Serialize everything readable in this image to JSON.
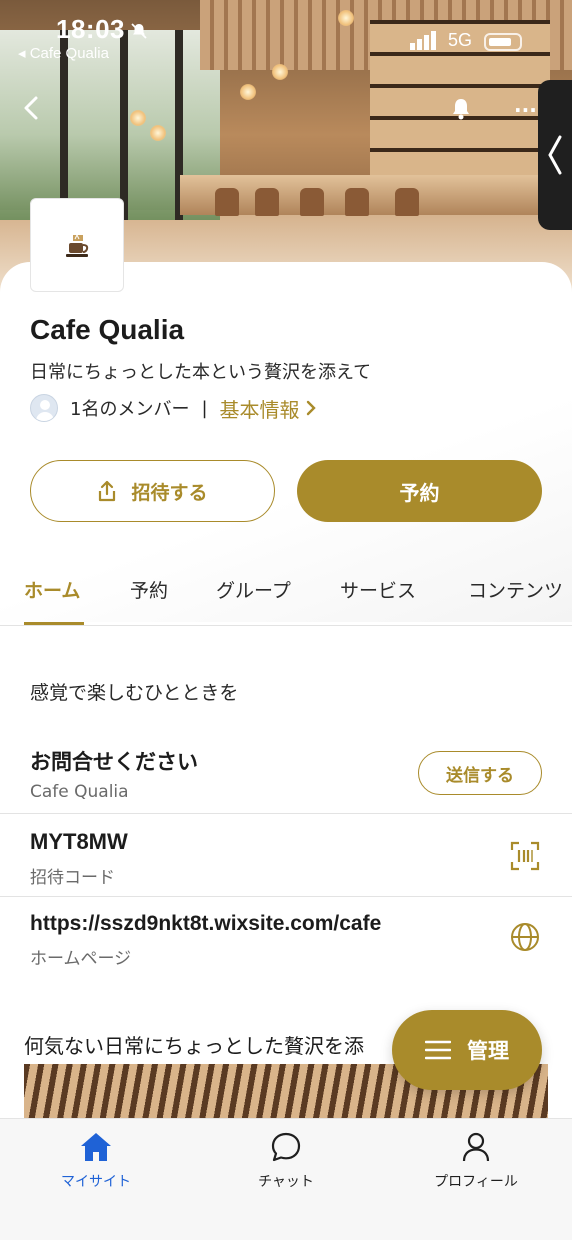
{
  "status_bar": {
    "time": "18:03",
    "back_app": "◂ Cafe Qualia",
    "network": "5G"
  },
  "site": {
    "title": "Cafe Qualia",
    "tagline": "日常にちょっとした本という贅沢を添えて",
    "members": "1名のメンバー",
    "separator": "|",
    "info_link": "基本情報"
  },
  "actions": {
    "invite_label": "招待する",
    "reserve_label": "予約"
  },
  "tabs": [
    {
      "label": "ホーム",
      "active": true
    },
    {
      "label": "予約"
    },
    {
      "label": "グループ"
    },
    {
      "label": "サービス"
    },
    {
      "label": "コンテンツ"
    }
  ],
  "content": {
    "heading": "感覚で楽しむひとときを",
    "contact": {
      "title": "お問合せください",
      "subtitle": "Cafe Qualia",
      "button": "送信する"
    },
    "invite_code": {
      "code": "MYT8MW",
      "label": "招待コード"
    },
    "homepage": {
      "url": "https://sszd9nkt8t.wixsite.com/cafe",
      "label": "ホームページ"
    },
    "post_heading": "何気ない日常にちょっとした贅沢を添"
  },
  "fab": {
    "label": "管理"
  },
  "bottom_nav": [
    {
      "label": "マイサイト",
      "icon": "home-icon",
      "active": true
    },
    {
      "label": "チャット",
      "icon": "chat-icon"
    },
    {
      "label": "プロフィール",
      "icon": "person-icon"
    }
  ],
  "colors": {
    "accent": "#a98b2b",
    "nav_active": "#1f62d6"
  }
}
